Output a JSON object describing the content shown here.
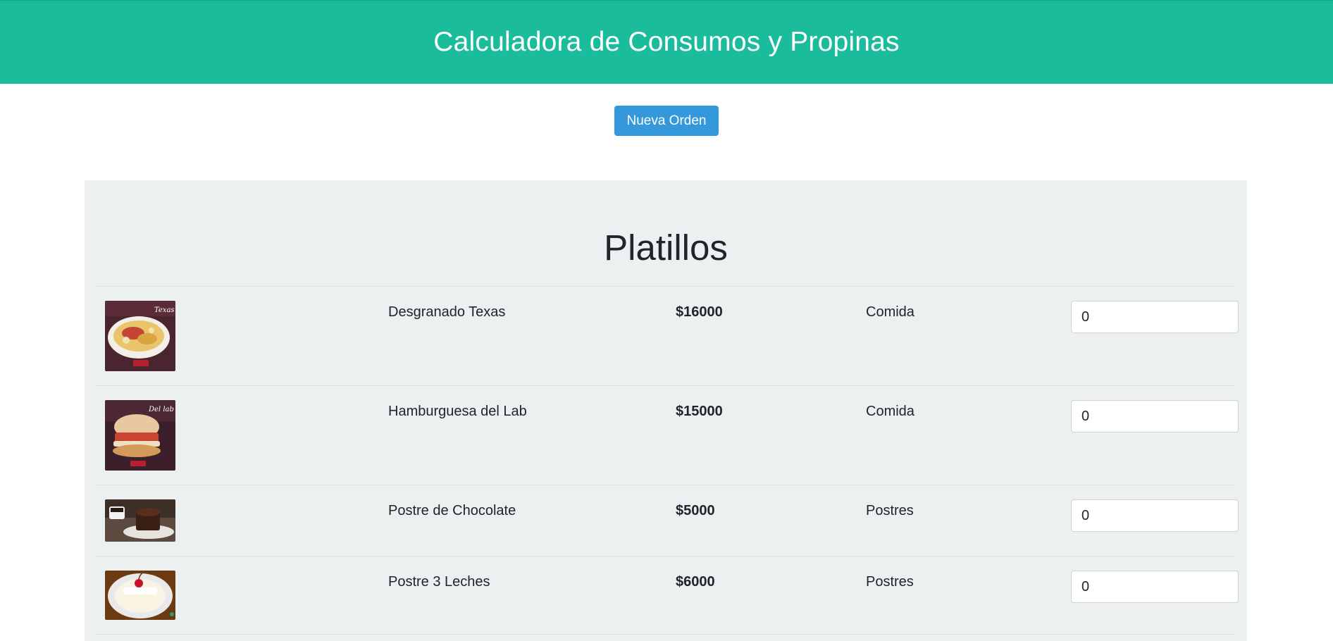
{
  "header": {
    "title": "Calculadora de Consumos y Propinas"
  },
  "actions": {
    "new_order_label": "Nueva Orden"
  },
  "menu": {
    "title": "Platillos",
    "items": [
      {
        "name": "Desgranado Texas",
        "price": "$16000",
        "category": "Comida",
        "quantity": "0"
      },
      {
        "name": "Hamburguesa del Lab",
        "price": "$15000",
        "category": "Comida",
        "quantity": "0"
      },
      {
        "name": "Postre de Chocolate",
        "price": "$5000",
        "category": "Postres",
        "quantity": "0"
      },
      {
        "name": "Postre 3 Leches",
        "price": "$6000",
        "category": "Postres",
        "quantity": "0"
      }
    ]
  },
  "colors": {
    "header_bg": "#1abc9c",
    "button_bg": "#3498db",
    "panel_bg": "#ecf0f1"
  }
}
